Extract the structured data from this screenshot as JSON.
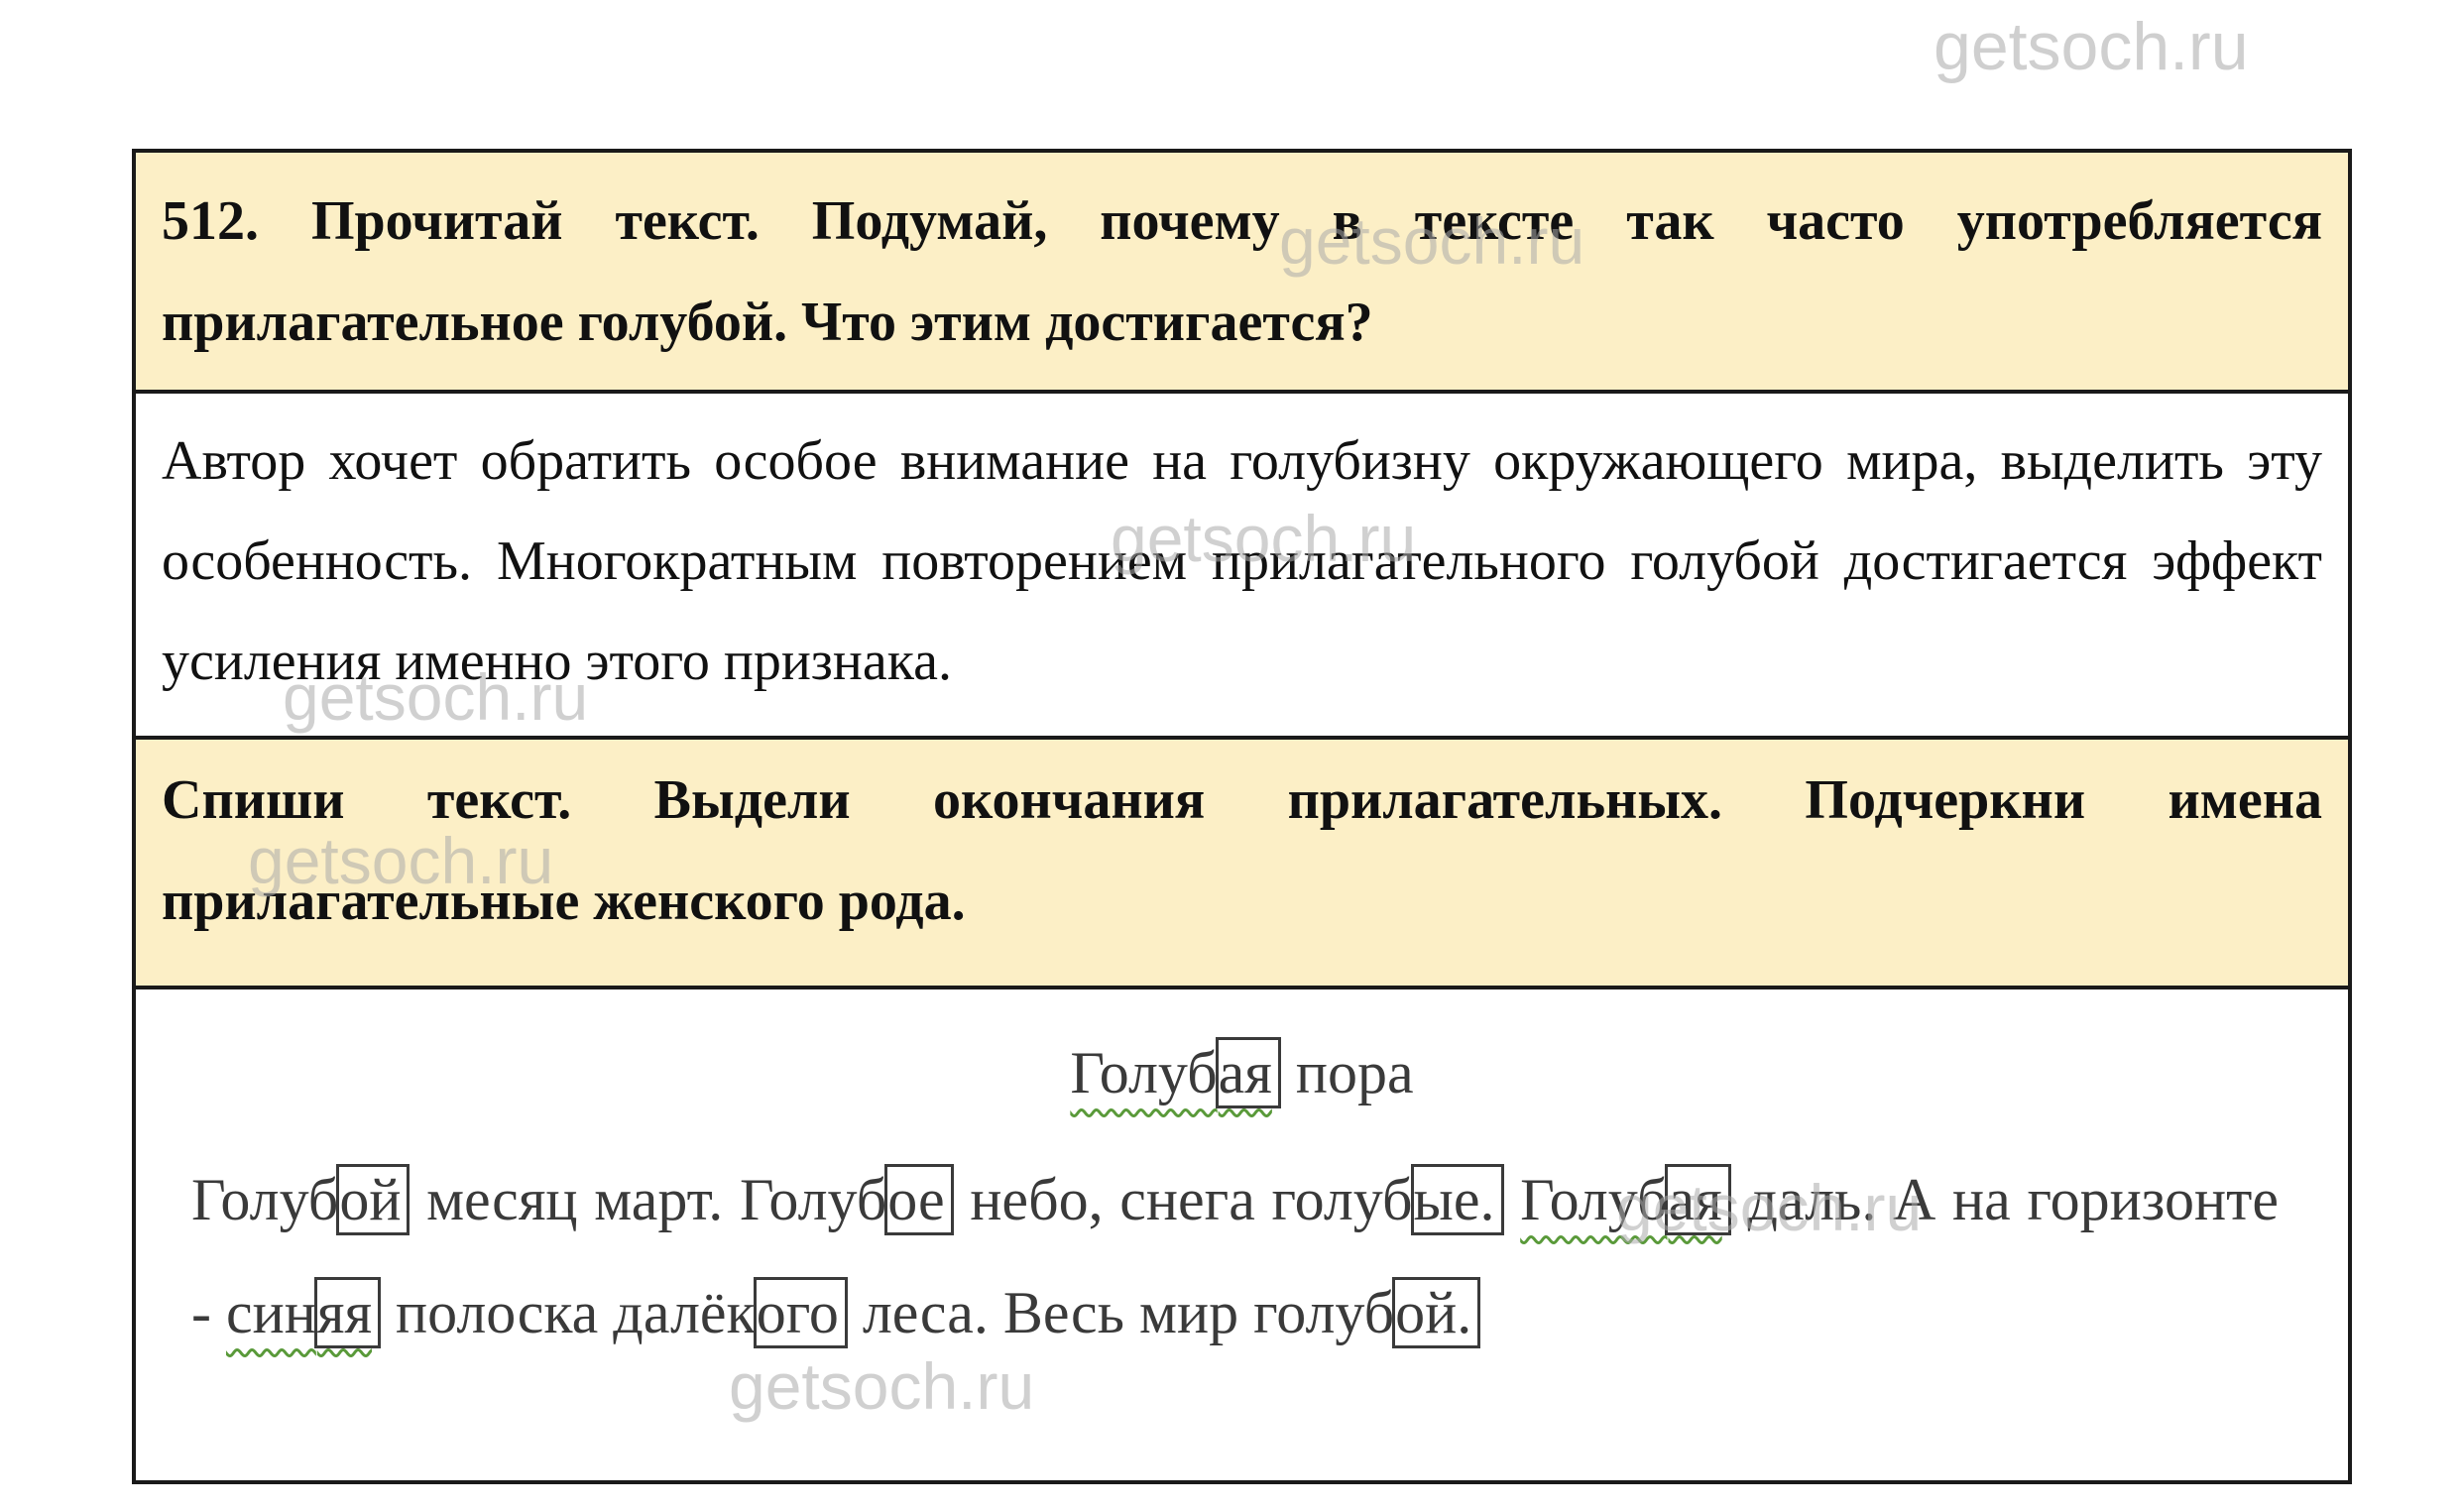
{
  "watermark": "getsoch.ru",
  "task1": {
    "text": "512. Прочитай текст. Подумай, почему в тексте так часто употребляется прилагательное голубой. Что этим достигается?"
  },
  "answer1": {
    "text": "Автор хочет обратить особое внимание на голубизну окружающего мира, выделить эту особенность. Многократным повторением прилагательного голубой достигается эффект усиления именно этого признака."
  },
  "task2": {
    "text": "Спиши текст. Выдели окончания прилагательных. Подчеркни имена прилагательные женского рода."
  },
  "answer2": {
    "title": {
      "stem": "Голуб",
      "ending": "ая",
      "rest": " пора"
    },
    "w1_stem": "Голуб",
    "w1_end": "ой",
    "t1": " месяц март. ",
    "w2_stem": "Голуб",
    "w2_end": "ое",
    "t2": " небо, снега голуб",
    "w3_end": "ые.",
    "t3": " ",
    "w4_stem": "Голуб",
    "w4_end": "ая",
    "t4": " даль. А на горизонте - ",
    "w5_stem": "син",
    "w5_end": "яя",
    "t5": " полоска далёк",
    "w6_end": "ого",
    "t6": " леса. Весь мир голуб",
    "w7_end": "ой."
  },
  "colors": {
    "task_background": "#fcefc6",
    "border": "#1a1a1a",
    "underline": "#5a9a3a"
  }
}
